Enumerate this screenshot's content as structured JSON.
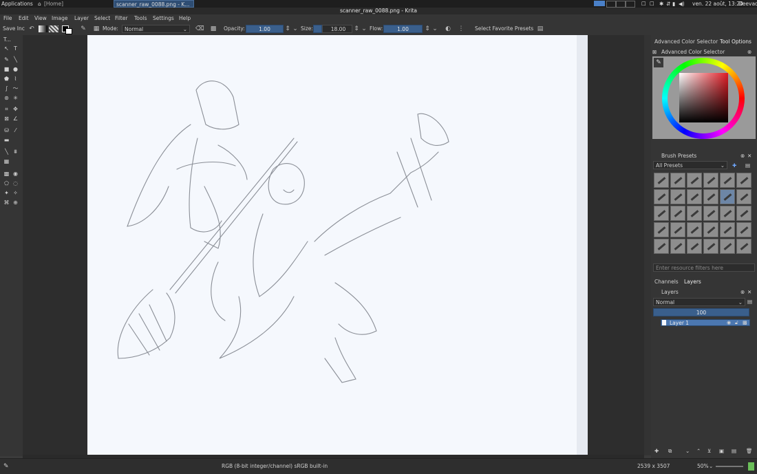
{
  "taskbar": {
    "applications": "Applications",
    "home": "[Home]",
    "active_task": "scanner_raw_0088.png - K...",
    "clock": "ven. 22 août, 13:20",
    "user": "Deevad"
  },
  "window": {
    "title": "scanner_raw_0088.png - Krita"
  },
  "menu": [
    "File",
    "Edit",
    "View",
    "Image",
    "Layer",
    "Select",
    "Filter",
    "Tools",
    "Settings",
    "Help"
  ],
  "toolbar": {
    "save_inc": "Save Inc",
    "mode_label": "Mode:",
    "mode_value": "Normal",
    "opacity_label": "Opacity:",
    "opacity_value": "1.00",
    "size_label": "Size:",
    "size_value": "18.00",
    "flow_label": "Flow:",
    "flow_value": "1.00",
    "favorite_presets": "Select Favorite Presets"
  },
  "toolbox": {
    "title": "T..."
  },
  "dock": {
    "tabs": {
      "advanced_color": "Advanced Color Selector",
      "tool_options": "Tool Options"
    },
    "color_selector_title": "Advanced Color Selector",
    "brush_presets_title": "Brush Presets",
    "presets_filter": "All Presets",
    "resource_filter_placeholder": "Enter resource filters here",
    "channels_tab": "Channels",
    "layers_tab": "Layers",
    "layers_title": "Layers",
    "blend_mode": "Normal",
    "layer_opacity": "100",
    "layer_name": "Layer 1"
  },
  "status": {
    "color_space": "RGB (8-bit integer/channel)  sRGB built-in",
    "image_size": "2539 x 3507",
    "zoom": "50%"
  },
  "colors": {
    "accent": "#3a5f8c",
    "paper": "#f5f8fd",
    "ui_bg": "#353535"
  }
}
